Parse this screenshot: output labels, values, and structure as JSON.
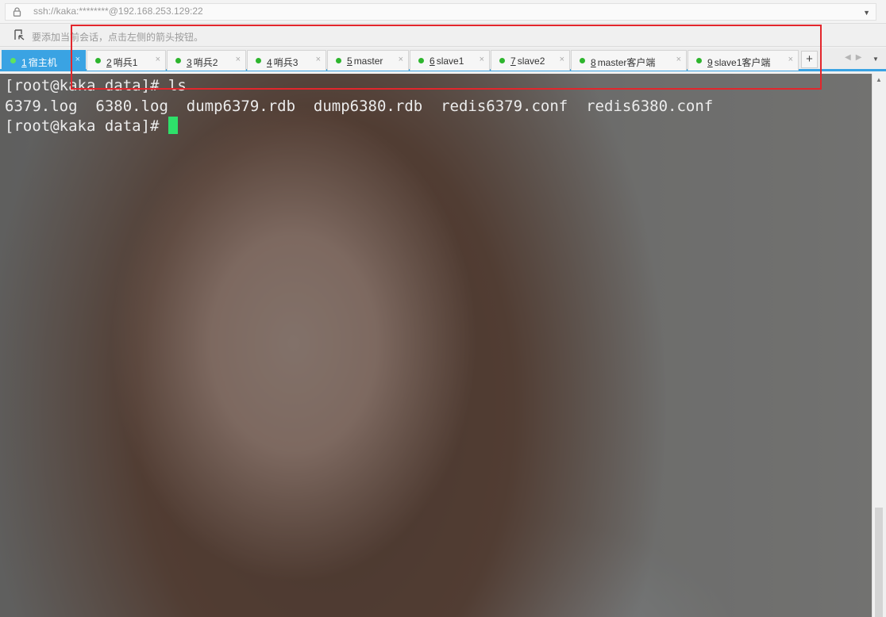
{
  "address": {
    "text": "ssh://kaka:********@192.168.253.129:22"
  },
  "hint": {
    "text": "要添加当前会话，点击左侧的箭头按钮。"
  },
  "tabs": [
    {
      "num": "1",
      "label": "宿主机"
    },
    {
      "num": "2",
      "label": "哨兵1"
    },
    {
      "num": "3",
      "label": "哨兵2"
    },
    {
      "num": "4",
      "label": "哨兵3"
    },
    {
      "num": "5",
      "label": "master"
    },
    {
      "num": "6",
      "label": "slave1"
    },
    {
      "num": "7",
      "label": "slave2"
    },
    {
      "num": "8",
      "label": "master客户端"
    },
    {
      "num": "9",
      "label": "slave1客户端"
    }
  ],
  "tab_close_glyph": "×",
  "add_tab_label": "+",
  "terminal": {
    "lines": [
      "[root@kaka data]# ls",
      "6379.log  6380.log  dump6379.rdb  dump6380.rdb  redis6379.conf  redis6380.conf",
      "[root@kaka data]# "
    ]
  },
  "colors": {
    "tab_active": "#3aa3e3",
    "status_dot": "#2db52d",
    "cursor": "#2ee06a",
    "annotation_border": "#e3262c"
  }
}
